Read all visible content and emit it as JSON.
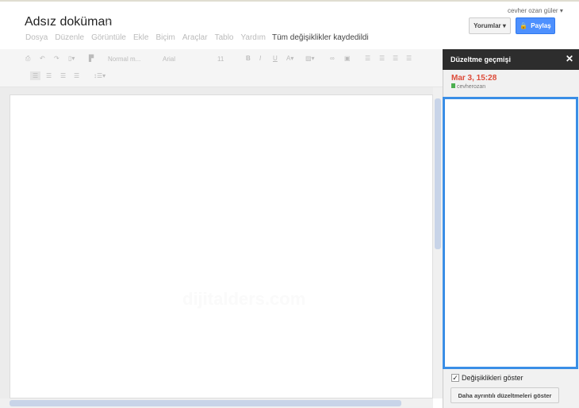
{
  "document": {
    "title": "Adsız doküman",
    "save_status": "Tüm değişiklikler kaydedildi",
    "watermark": "dijitalders.com"
  },
  "menu": [
    "Dosya",
    "Düzenle",
    "Görüntüle",
    "Ekle",
    "Biçim",
    "Araçlar",
    "Tablo",
    "Yardım"
  ],
  "account": {
    "user_name": "cevher ozan güler ▾"
  },
  "header": {
    "comments_label": "Yorumlar ▾",
    "share_label": "Paylaş"
  },
  "toolbar": {
    "style_value": "Normal m...",
    "font_value": "Arial",
    "size_value": "11"
  },
  "revision_panel": {
    "title": "Düzeltme geçmişi",
    "close": "✕",
    "revisions": [
      {
        "date": "Mar 3, 15:28",
        "author": "cevherozan",
        "color": "#4caf50"
      }
    ],
    "show_changes_label": "Değişiklikleri göster",
    "show_changes_checked": true,
    "detailed_button": "Daha ayrıntılı düzeltmeleri göster"
  },
  "colors": {
    "accent": "#4d90fe",
    "revision_date": "#dd4b39",
    "selection_border": "#3a8ee6"
  }
}
